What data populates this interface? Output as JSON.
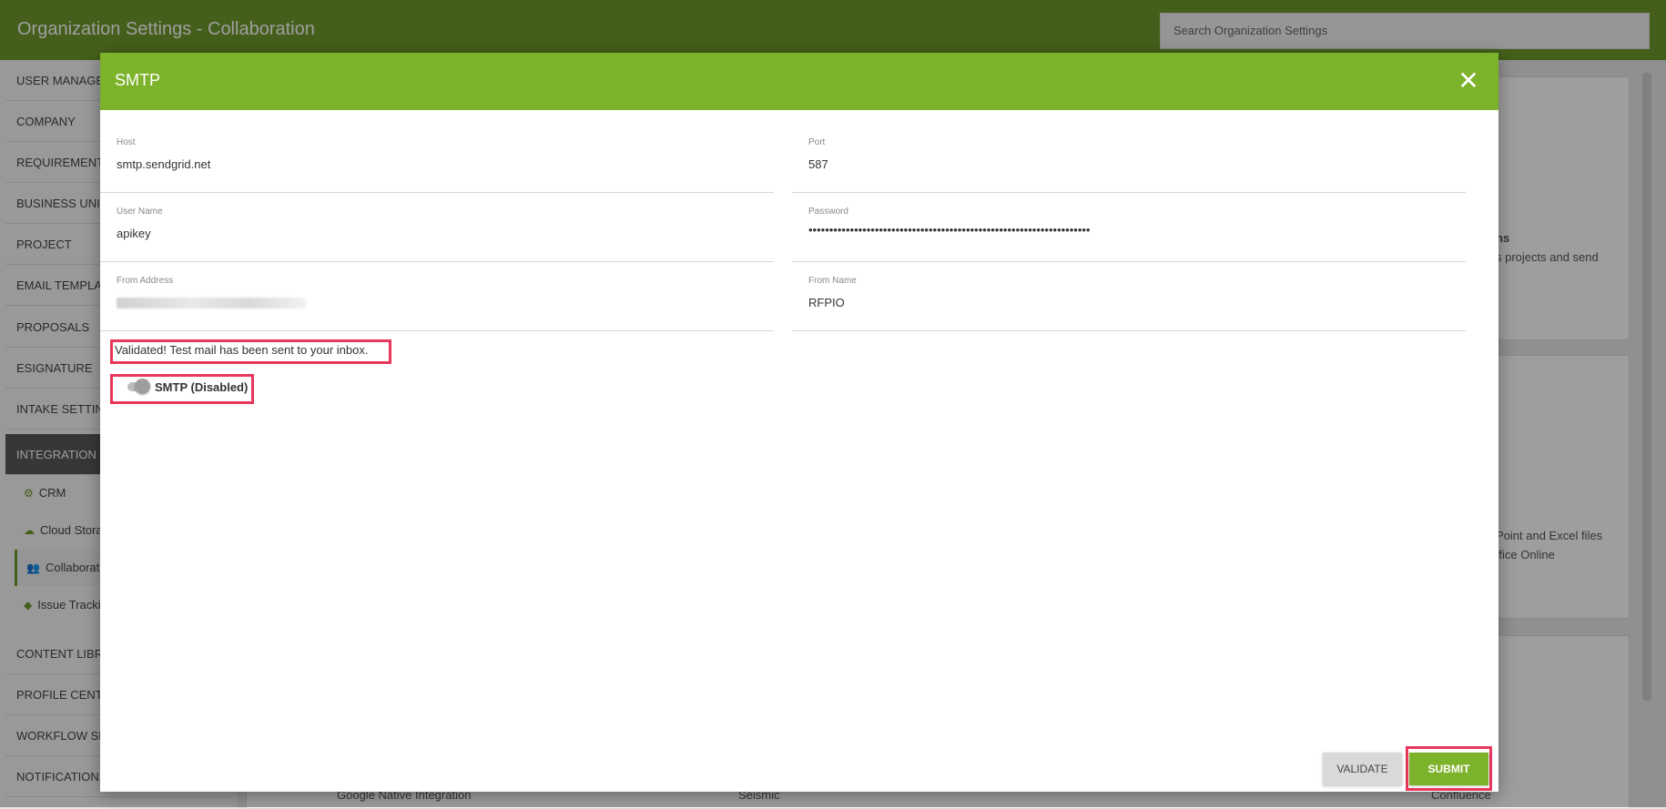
{
  "page": {
    "title": "Organization Settings - Collaboration",
    "search_placeholder": "Search Organization Settings"
  },
  "sidebar": {
    "items": [
      {
        "label": "USER MANAGEMENT"
      },
      {
        "label": "COMPANY"
      },
      {
        "label": "REQUIREMENTS"
      },
      {
        "label": "BUSINESS UNITS"
      },
      {
        "label": "PROJECT"
      },
      {
        "label": "EMAIL TEMPLATES"
      },
      {
        "label": "PROPOSALS"
      },
      {
        "label": "ESIGNATURE"
      },
      {
        "label": "INTAKE SETTINGS"
      },
      {
        "label": "INTEGRATION"
      },
      {
        "label": "CONTENT LIBRARY"
      },
      {
        "label": "PROFILE CENTER"
      },
      {
        "label": "WORKFLOW SETTINGS"
      },
      {
        "label": "NOTIFICATIONS"
      }
    ],
    "integration_subitems": [
      {
        "label": "CRM",
        "icon": "gears-icon"
      },
      {
        "label": "Cloud Storage",
        "icon": "cloud-icon"
      },
      {
        "label": "Collaboration",
        "icon": "users-icon"
      },
      {
        "label": "Issue Tracking",
        "icon": "tag-icon"
      }
    ]
  },
  "background": {
    "card1_bold": "ns",
    "card1_text": "s projects and send",
    "card2_line1": "Point and Excel files",
    "card2_line2": "ffice Online",
    "bottom_left": "Google Native Integration",
    "bottom_mid": "Seismic",
    "bottom_right": "Confluence"
  },
  "modal": {
    "title": "SMTP",
    "close_icon": "close-icon",
    "fields": {
      "host": {
        "label": "Host",
        "value": "smtp.sendgrid.net"
      },
      "port": {
        "label": "Port",
        "value": "587"
      },
      "username": {
        "label": "User Name",
        "value": "apikey"
      },
      "password": {
        "label": "Password",
        "value": "••••••••••••••••••••••••••••••••••••••••••••••••••••••••••••••••••••"
      },
      "from_address": {
        "label": "From Address",
        "value": ""
      },
      "from_name": {
        "label": "From Name",
        "value": "RFPIO"
      }
    },
    "validated_message": "Validated! Test mail has been sent to your inbox.",
    "smtp_toggle": {
      "label": "SMTP (Disabled)",
      "enabled": false
    },
    "buttons": {
      "validate": "VALIDATE",
      "submit": "SUBMIT"
    }
  },
  "colors": {
    "header_green": "#7db22b",
    "topbar_green": "#6f9a2c",
    "highlight": "#e8375a"
  }
}
